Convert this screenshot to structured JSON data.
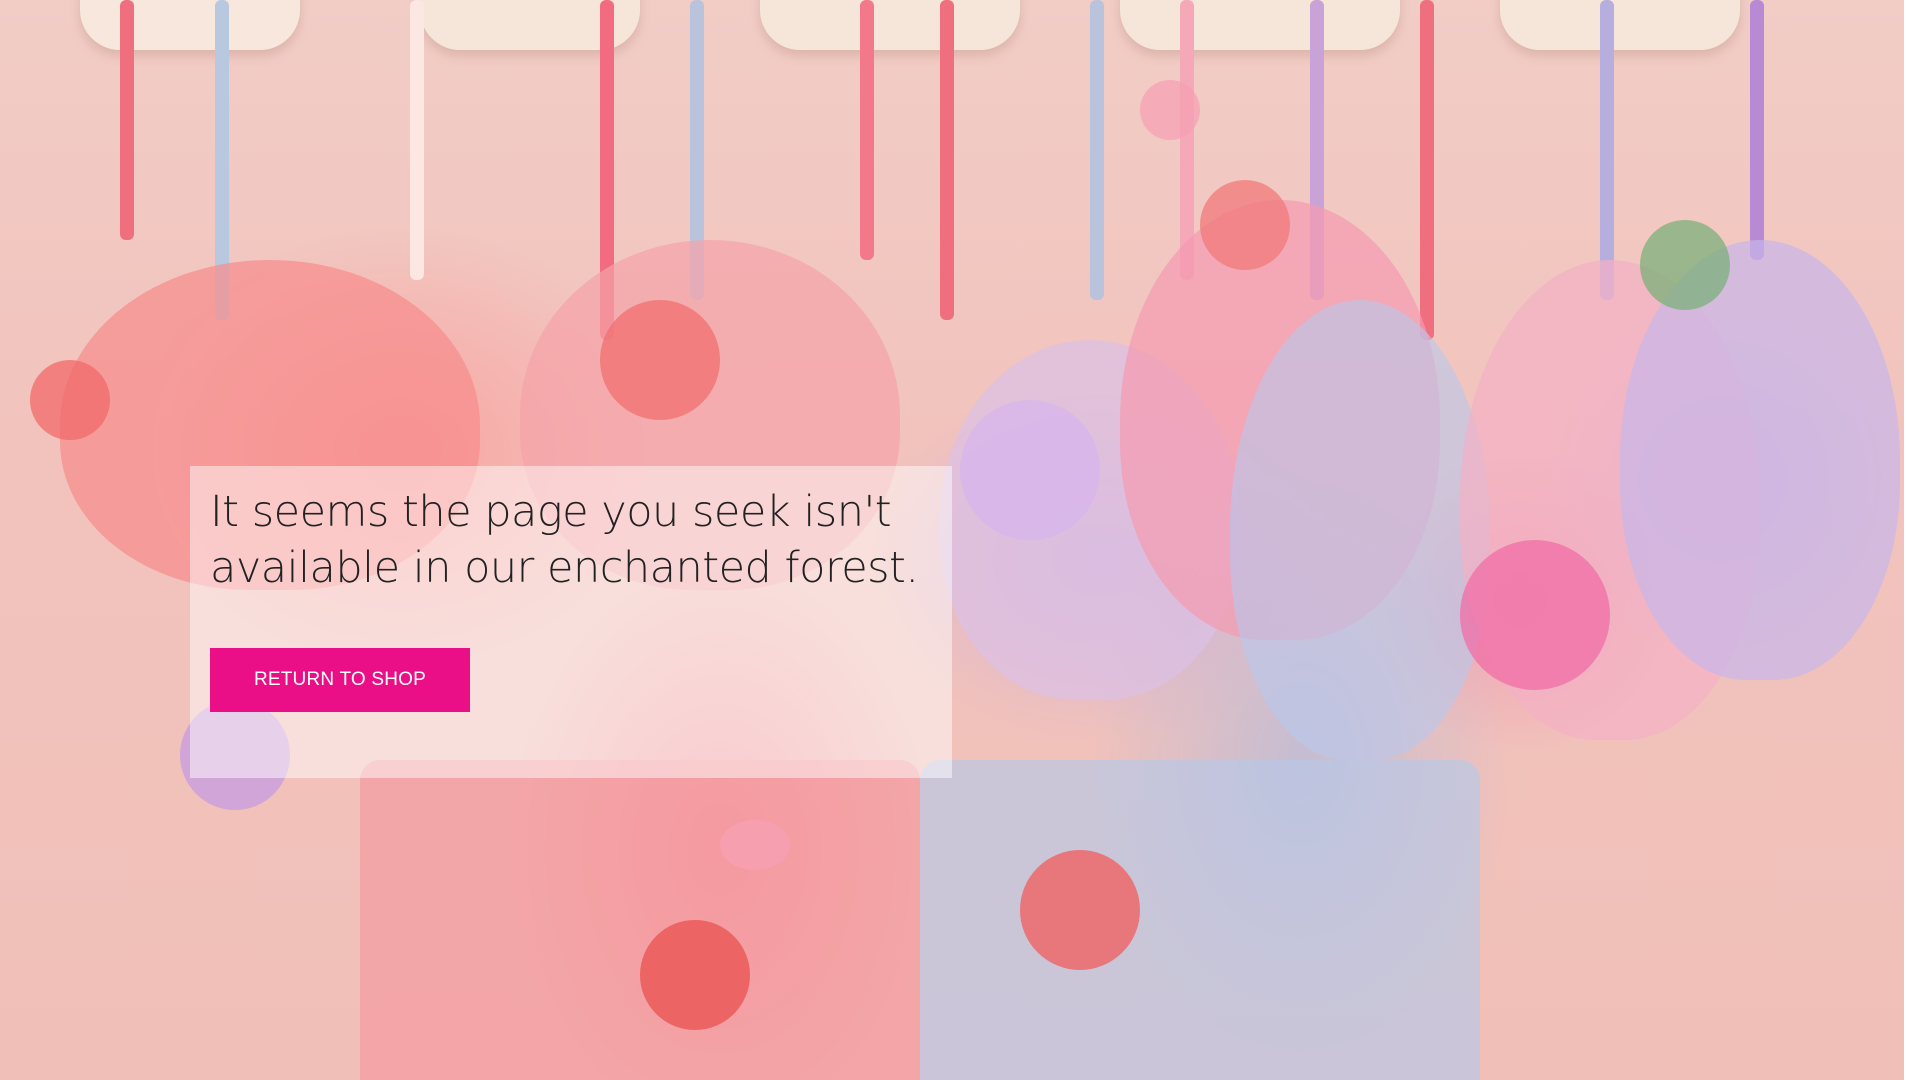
{
  "error_message": "It seems the page you seek isn't available in our enchanted forest.",
  "return_button_label": "RETURN TO SHOP",
  "colors": {
    "button_background": "#ea0f86",
    "button_text": "#ffffff",
    "panel_background": "rgba(255,255,255,0.48)",
    "message_text": "#222222"
  },
  "background_image": "pastel embroidered lingerie on hangers"
}
